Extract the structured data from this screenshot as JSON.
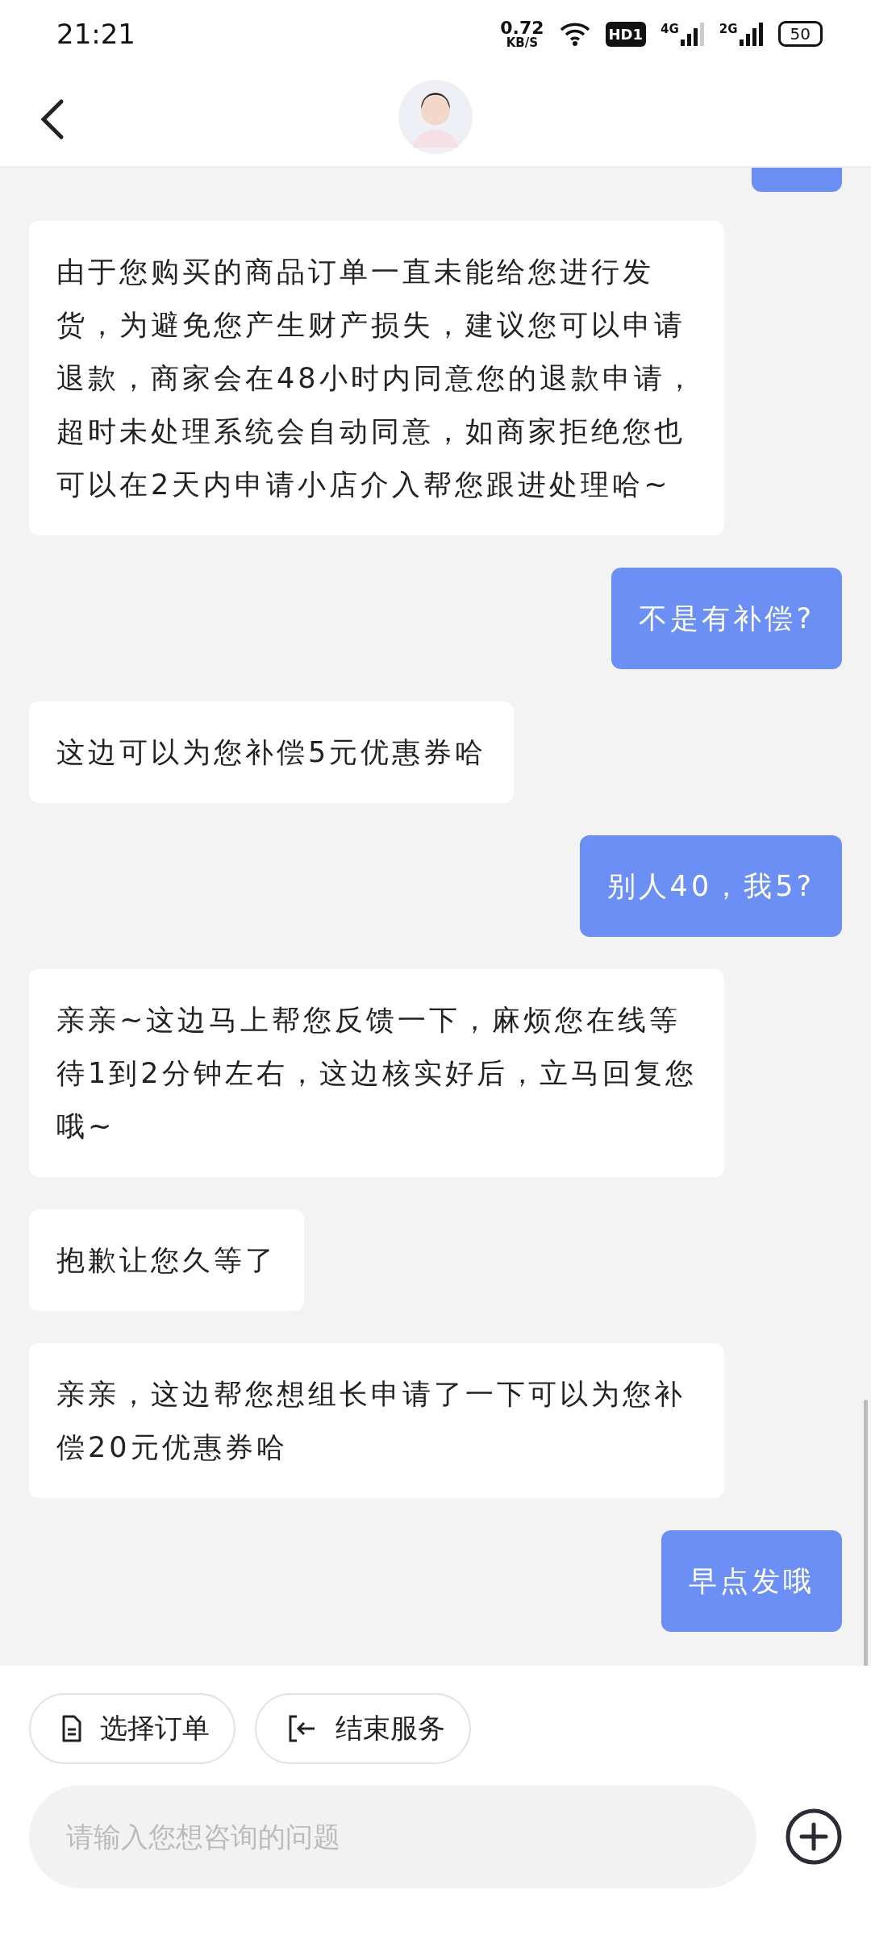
{
  "status_bar": {
    "time": "21:21",
    "speed_value": "0.72",
    "speed_unit": "KB/S",
    "hd_badge": "HD1",
    "networks": [
      "4G",
      "2G"
    ],
    "battery": "50"
  },
  "messages": [
    {
      "kind": "agent",
      "text": "由于您购买的商品订单一直未能给您进行发货，为避免您产生财产损失，建议您可以申请退款，商家会在48小时内同意您的退款申请，超时未处理系统会自动同意，如商家拒绝您也可以在2天内申请小店介入帮您跟进处理哈~"
    },
    {
      "kind": "user",
      "text": "不是有补偿?"
    },
    {
      "kind": "agent",
      "text": "这边可以为您补偿5元优惠券哈"
    },
    {
      "kind": "user",
      "text": "别人40，我5?"
    },
    {
      "kind": "agent",
      "text": "亲亲~这边马上帮您反馈一下，麻烦您在线等待1到2分钟左右，这边核实好后，立马回复您哦~"
    },
    {
      "kind": "agent",
      "text": "抱歉让您久等了"
    },
    {
      "kind": "agent",
      "text": "亲亲，这边帮您想组长申请了一下可以为您补偿20元优惠券哈"
    },
    {
      "kind": "user",
      "text": "早点发哦"
    }
  ],
  "quick_actions": [
    {
      "kind": "order",
      "label": "选择订单"
    },
    {
      "kind": "exit",
      "label": "结束服务"
    }
  ],
  "input": {
    "placeholder": "请输入您想咨询的问题"
  }
}
